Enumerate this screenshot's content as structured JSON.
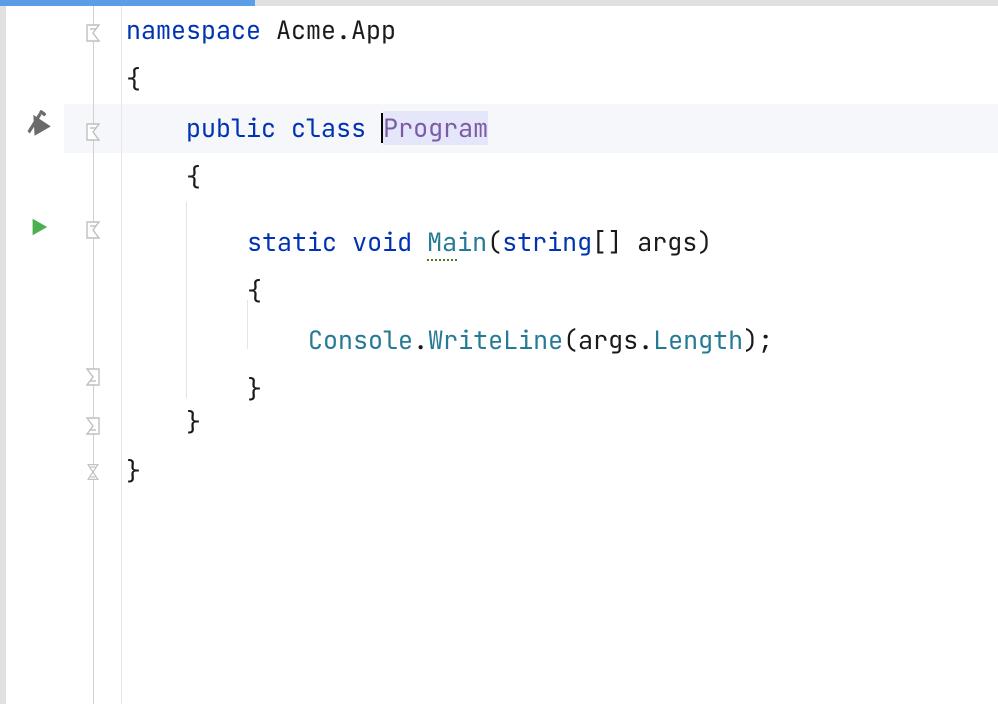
{
  "line_height": 49,
  "gutter": {
    "build_icon_line": 2,
    "run_icon_line": 4
  },
  "fold_markers": [
    {
      "line": 0,
      "type": "open"
    },
    {
      "line": 2,
      "type": "open"
    },
    {
      "line": 4,
      "type": "open"
    },
    {
      "line": 7,
      "type": "close"
    },
    {
      "line": 8,
      "type": "close"
    },
    {
      "line": 9,
      "type": "close-both"
    }
  ],
  "current_line": 2,
  "code": {
    "ns_kw": "namespace",
    "ns_name": "Acme.App",
    "brace_open": "{",
    "brace_close": "}",
    "public_kw": "public",
    "class_kw": "class",
    "class_name": "Program",
    "static_kw": "static",
    "void_kw": "void",
    "main_name": "Main",
    "main_underline_part": "Ma",
    "main_rest": "in",
    "paren_open": "(",
    "paren_close": ")",
    "string_kw": "string",
    "array_brackets": "[]",
    "args_name": "args",
    "console_name": "Console",
    "writeline_name": "WriteLine",
    "dot": ".",
    "length_name": "Length",
    "semicolon": ";"
  },
  "indent": {
    "l0": "",
    "l1": "    ",
    "l2": "        ",
    "l3": "            "
  }
}
